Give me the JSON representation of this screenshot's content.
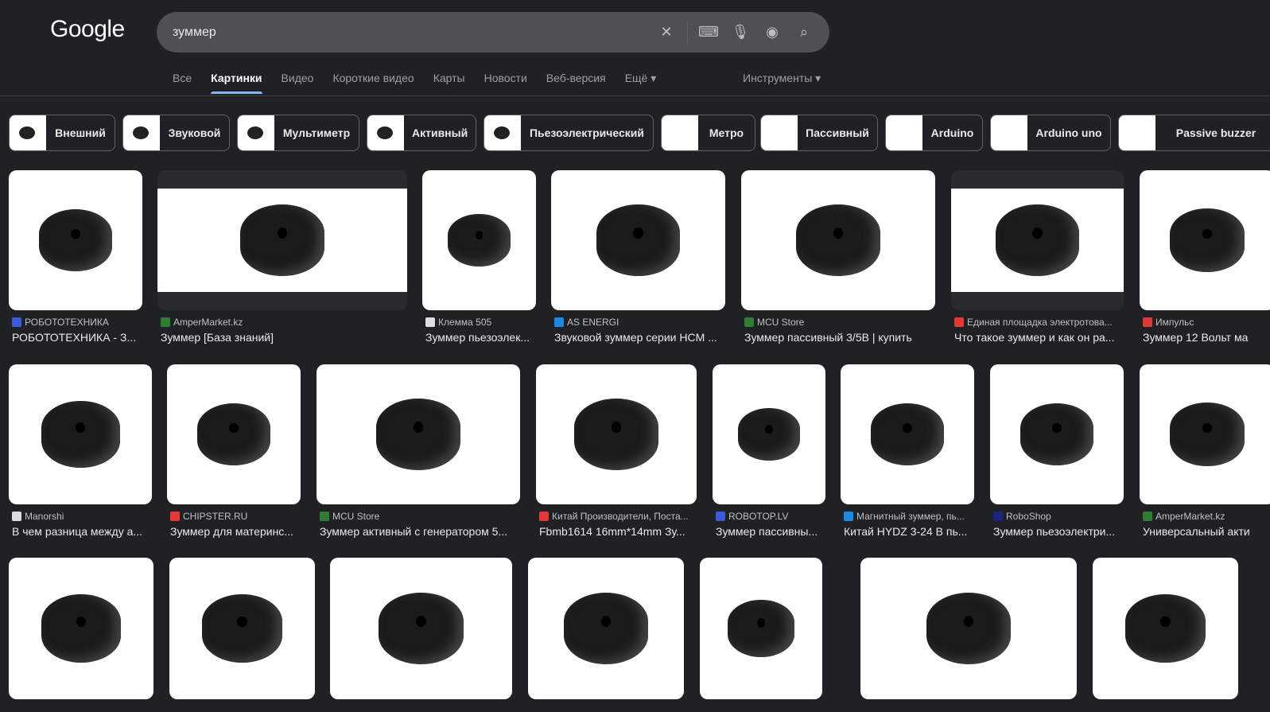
{
  "header": {
    "logo": "Google",
    "query": "зуммер"
  },
  "tabs": [
    {
      "label": "Все"
    },
    {
      "label": "Картинки",
      "active": true
    },
    {
      "label": "Видео"
    },
    {
      "label": "Короткие видео"
    },
    {
      "label": "Карты"
    },
    {
      "label": "Новости"
    },
    {
      "label": "Веб-версия"
    },
    {
      "label": "Ещё ▾"
    }
  ],
  "tools_label": "Инструменты ▾",
  "chips": [
    "Внешний",
    "Звуковой",
    "Мультиметр",
    "Активный",
    "Пьезоэлектрический",
    "Метро",
    "Пассивный",
    "Arduino",
    "Arduino uno",
    "Passive buzzer"
  ],
  "results": [
    {
      "source": "РОБОТОТЕХНИКА",
      "title": "РОБОТОТЕХНИКА - З...",
      "fav": "#3b5bdb"
    },
    {
      "source": "AmperMarket.kz",
      "title": "Зуммер [База знаний]",
      "fav": "#2e7d32"
    },
    {
      "source": "Клемма 505",
      "title": "Зуммер пьезоэлек...",
      "fav": "#ddd"
    },
    {
      "source": "AS ENERGI",
      "title": "Звуковой зуммер серии HCM ...",
      "fav": "#1e88e5"
    },
    {
      "source": "MCU Store",
      "title": "Зуммер пассивный 3/5В | купить",
      "fav": "#2e7d32"
    },
    {
      "source": "Единая площадка электротова...",
      "title": "Что такое зуммер и как он ра...",
      "fav": "#e53935"
    },
    {
      "source": "Импульс",
      "title": "Зуммер 12 Вольт ма",
      "fav": "#e53935"
    },
    {
      "source": "Manorshi",
      "title": "В чем разница между а...",
      "fav": "#ddd"
    },
    {
      "source": "CHIPSTER.RU",
      "title": "Зуммер для материнс...",
      "fav": "#e53935"
    },
    {
      "source": "MCU Store",
      "title": "Зуммер активный с генератором 5...",
      "fav": "#2e7d32"
    },
    {
      "source": "Китай Производители, Поста...",
      "title": "Fbmb1614 16mm*14mm Зу...",
      "fav": "#e53935"
    },
    {
      "source": "ROBOTOP.LV",
      "title": "Зуммер пассивны...",
      "fav": "#3b5bdb"
    },
    {
      "source": "Магнитный зуммер, пь...",
      "title": "Китай HYDZ 3-24 В пь...",
      "fav": "#1e88e5"
    },
    {
      "source": "RoboShop",
      "title": "Зуммер пьезоэлектри...",
      "fav": "#1a237e"
    },
    {
      "source": "AmperMarket.kz",
      "title": "Универсальный акти",
      "fav": "#2e7d32"
    },
    {},
    {},
    {},
    {},
    {},
    {},
    {}
  ]
}
